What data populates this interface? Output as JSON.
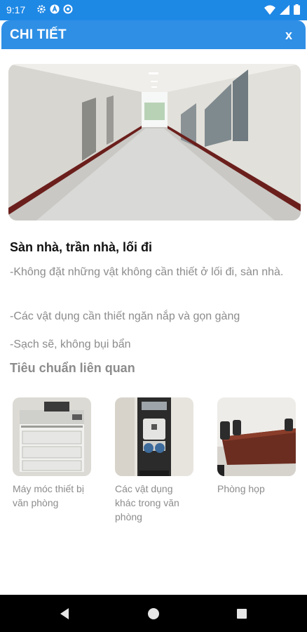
{
  "status_bar": {
    "time": "9:17"
  },
  "header": {
    "title": "CHI TIẾT",
    "close_label": "x"
  },
  "content": {
    "section_title": "Sàn nhà, trần nhà, lối đi",
    "paragraphs": [
      "-Không đặt những vật không cần thiết ở lối đi, sàn nhà.",
      "-Các vật dụng cần thiết ngăn nắp và gọn gàng",
      "-Sạch sẽ, không bụi bẩn"
    ],
    "related_title": "Tiêu chuẩn liên quan",
    "related_items": [
      {
        "label": "Máy móc thiết bị văn phòng"
      },
      {
        "label": "Các vật dụng khác trong văn phòng"
      },
      {
        "label": "Phòng họp"
      }
    ]
  },
  "colors": {
    "status_bar": "#1e88e5",
    "header": "#2f8fe5",
    "body_text": "#8c8c8c",
    "title_text": "#111111"
  }
}
